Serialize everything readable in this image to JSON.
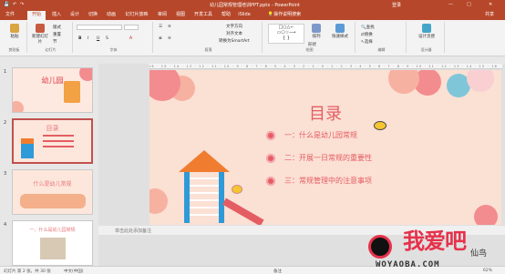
{
  "window": {
    "title": "幼儿园常规管理培训PPT.pptx - PowerPoint",
    "sign_in": "登录",
    "share": "共享"
  },
  "tabs": [
    "文件",
    "开始",
    "插入",
    "设计",
    "切换",
    "动画",
    "幻灯片放映",
    "审阅",
    "视图",
    "开发工具",
    "帮助",
    "iSlide"
  ],
  "tell_me": "操作说明搜索",
  "ribbon": {
    "groups": [
      {
        "label": "剪贴板",
        "buttons": [
          "粘贴"
        ]
      },
      {
        "label": "幻灯片",
        "buttons": [
          "新建幻灯片",
          "版式",
          "重置",
          "节"
        ]
      },
      {
        "label": "字体",
        "buttons": [
          "B",
          "I",
          "U",
          "S",
          "A"
        ]
      },
      {
        "label": "段落",
        "buttons": [
          "文字方向",
          "对齐文本",
          "转换为SmartArt"
        ]
      },
      {
        "label": "绘图",
        "buttons": [
          "形状",
          "排列",
          "快速样式"
        ]
      },
      {
        "label": "编辑",
        "buttons": [
          "查找",
          "替换",
          "选择"
        ]
      },
      {
        "label": "设计器",
        "buttons": [
          "设计灵感"
        ]
      }
    ]
  },
  "slides": [
    {
      "num": "1",
      "title": "幼儿园"
    },
    {
      "num": "2",
      "title": "目录"
    },
    {
      "num": "3",
      "title": "什么是幼儿常规"
    },
    {
      "num": "4",
      "title": "一、什么是幼儿园常规"
    }
  ],
  "ruler_text": "16 · 15 · 14 · 13 · 12 · 11 · 10 · 9 · 8 · 7 · 6 · 5 · 4 · 3 · 2 · 1 · 0 · 1 · 2 · 3 · 4 · 5 · 6 · 7 · 8 · 9 · 10 · 11 · 12 · 13 · 14 · 15 · 16",
  "slide": {
    "title": "目录",
    "items": [
      "一：什么是幼儿园常规",
      "二：开展一日常规的重要性",
      "三：常规管理中的注意事项"
    ]
  },
  "notes_placeholder": "单击此处添加备注",
  "status": {
    "slide_info": "幻灯片 第 2 张，共 30 张",
    "language": "中文(中国)",
    "notes": "备注",
    "zoom": "62%"
  },
  "watermark": {
    "brand": "我爱吧",
    "site": "WOYAOBA.COM",
    "extra": "仙鸟"
  },
  "colors": {
    "accent": "#b7472a",
    "slide_bg": "#fbe0d4",
    "title_pink": "#e45d63"
  }
}
